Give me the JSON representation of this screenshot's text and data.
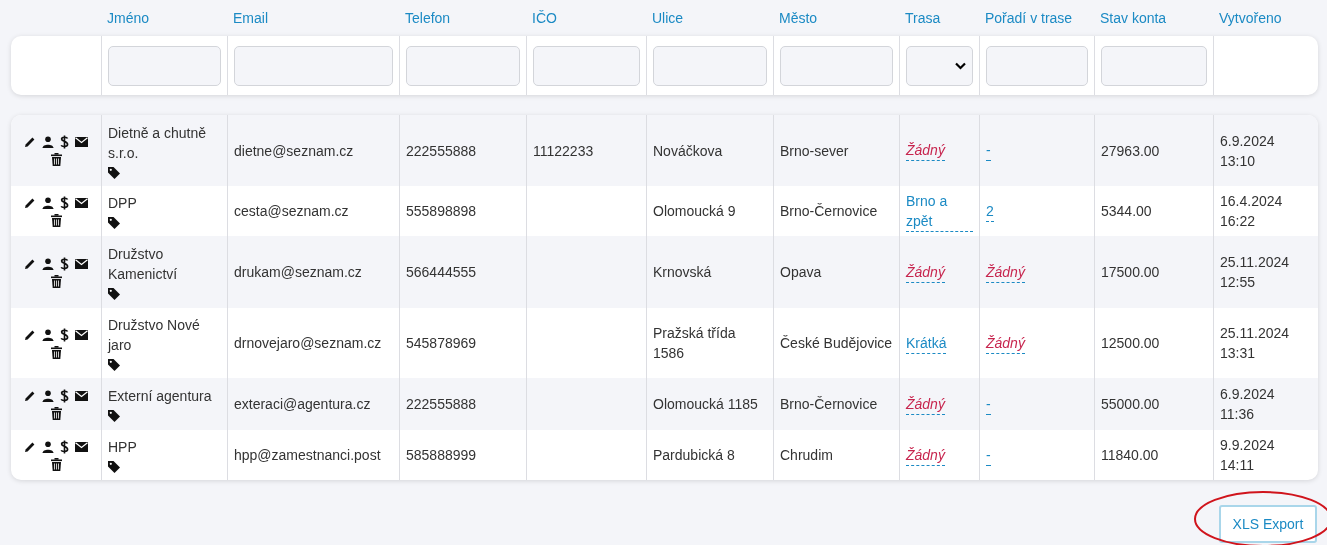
{
  "columns": [
    "Jméno",
    "Email",
    "Telefon",
    "IČO",
    "Ulice",
    "Město",
    "Trasa",
    "Pořadí v trase",
    "Stav konta",
    "Vytvořeno"
  ],
  "filters": [
    {
      "kind": "none"
    },
    {
      "kind": "text"
    },
    {
      "kind": "text"
    },
    {
      "kind": "text"
    },
    {
      "kind": "text"
    },
    {
      "kind": "text"
    },
    {
      "kind": "text"
    },
    {
      "kind": "select"
    },
    {
      "kind": "text"
    },
    {
      "kind": "text"
    },
    {
      "kind": "none"
    }
  ],
  "rows": [
    {
      "name": "Dietně a chutně s.r.o.",
      "email": "dietne@seznam.cz",
      "phone": "222555888",
      "ico": "11122233",
      "street": "Nováčkova",
      "city": "Brno-sever",
      "route": {
        "text": "Žádný",
        "kind": "empty"
      },
      "order": {
        "text": "-",
        "kind": "link"
      },
      "balance": "27963.00",
      "created": "6.9.2024 13:10"
    },
    {
      "name": "DPP",
      "email": "cesta@seznam.cz",
      "phone": "555898898",
      "ico": "",
      "street": "Olomoucká 9",
      "city": "Brno-Černovice",
      "route": {
        "text": "Brno a zpět",
        "kind": "link"
      },
      "order": {
        "text": "2",
        "kind": "link"
      },
      "balance": "5344.00",
      "created": "16.4.2024 16:22"
    },
    {
      "name": "Družstvo Kamenictví",
      "email": "drukam@seznam.cz",
      "phone": "566444555",
      "ico": "",
      "street": "Krnovská",
      "city": "Opava",
      "route": {
        "text": "Žádný",
        "kind": "empty"
      },
      "order": {
        "text": "Žádný",
        "kind": "empty"
      },
      "balance": "17500.00",
      "created": "25.11.2024 12:55"
    },
    {
      "name": "Družstvo Nové jaro",
      "email": "drnovejaro@seznam.cz",
      "phone": "545878969",
      "ico": "",
      "street": "Pražská třída 1586",
      "city": "České Budějovice",
      "route": {
        "text": "Krátká",
        "kind": "link"
      },
      "order": {
        "text": "Žádný",
        "kind": "empty"
      },
      "balance": "12500.00",
      "created": "25.11.2024 13:31"
    },
    {
      "name": "Externí agentura",
      "email": "exteraci@agentura.cz",
      "phone": "222555888",
      "ico": "",
      "street": "Olomoucká 1185",
      "city": "Brno-Černovice",
      "route": {
        "text": "Žádný",
        "kind": "empty"
      },
      "order": {
        "text": "-",
        "kind": "link"
      },
      "balance": "55000.00",
      "created": "6.9.2024 11:36"
    },
    {
      "name": "HPP",
      "email": "hpp@zamestnanci.post",
      "phone": "585888999",
      "ico": "",
      "street": "Pardubická 8",
      "city": "Chrudim",
      "route": {
        "text": "Žádný",
        "kind": "empty"
      },
      "order": {
        "text": "-",
        "kind": "link"
      },
      "balance": "11840.00",
      "created": "9.9.2024 14:11"
    }
  ],
  "export_button": {
    "label": "XLS Export",
    "highlight": {
      "kind": "ellipse"
    }
  }
}
